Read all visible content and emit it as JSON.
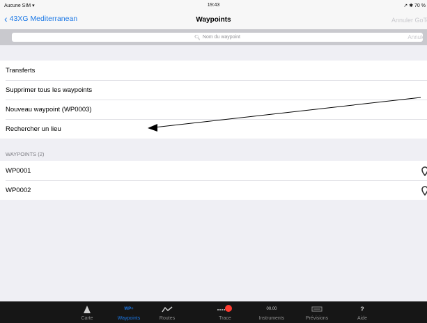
{
  "status": {
    "carrier": "Aucune SIM",
    "time": "19:43",
    "battery": "70 %"
  },
  "nav": {
    "back_label": "43XG Mediterranean",
    "title": "Waypoints",
    "right_action": "Annuler GoTo"
  },
  "search": {
    "placeholder": "Nom du waypoint",
    "cancel_label": "Annuler"
  },
  "actions": [
    {
      "label": "Transferts"
    },
    {
      "label": "Supprimer tous les waypoints"
    },
    {
      "label": "Nouveau waypoint (WP0003)"
    },
    {
      "label": "Rechercher un lieu"
    }
  ],
  "waypoints_header": "WAYPOINTS (2)",
  "waypoints": [
    {
      "name": "WP0001"
    },
    {
      "name": "WP0002"
    }
  ],
  "tabs": [
    {
      "label": "Carte",
      "icon": "map-arrow-icon",
      "active": false
    },
    {
      "label": "Waypoints",
      "icon": "waypoint-icon",
      "icon_text": "WP+",
      "active": true
    },
    {
      "label": "Routes",
      "icon": "route-icon",
      "active": false
    },
    {
      "label": "Trace",
      "icon": "track-icon",
      "active": false
    },
    {
      "label": "Instruments",
      "icon": "instruments-icon",
      "icon_text": "00.00",
      "active": false
    },
    {
      "label": "Prévisions",
      "icon": "forecast-icon",
      "active": false
    },
    {
      "label": "Aide",
      "icon": "help-icon",
      "icon_text": "?",
      "active": false
    }
  ],
  "colors": {
    "accent": "#1b78e6",
    "tabbar": "#161616",
    "background": "#efeff4",
    "track_dot": "#ff3b30"
  }
}
